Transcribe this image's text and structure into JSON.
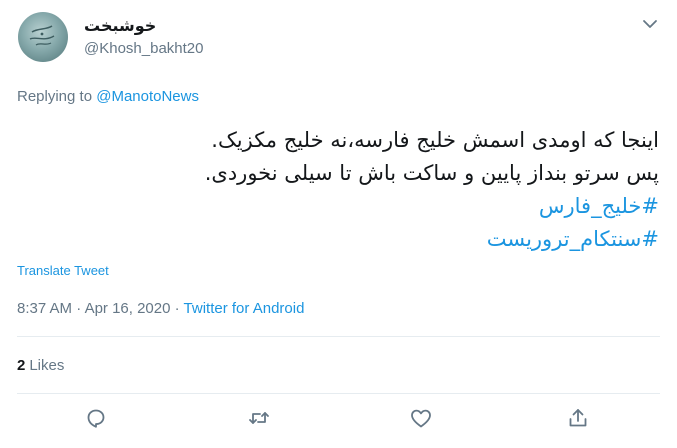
{
  "author": {
    "display_name": "خوشبخت",
    "handle": "@Khosh_bakht20"
  },
  "reply": {
    "prefix": "Replying to",
    "mention": "@ManotoNews"
  },
  "tweet": {
    "line1": "اینجا که اومدی اسمش خلیج فارسه،نه خلیج مکزیک.",
    "line2": "پس سرتو بنداز پایین و ساکت باش تا سیلی نخوردی.",
    "hashtag1": "#خلیج_فارس",
    "hashtag2": "#سنتکام_تروریست"
  },
  "translate_label": "Translate Tweet",
  "meta": {
    "time": "8:37 AM",
    "separator": "·",
    "date": "Apr 16, 2020",
    "source": "Twitter for Android"
  },
  "stats": {
    "likes_count": "2",
    "likes_label": "Likes"
  },
  "icons": {
    "reply": "reply-icon",
    "retweet": "retweet-icon",
    "like": "heart-icon",
    "share": "share-icon",
    "caret": "chevron-down-icon"
  },
  "colors": {
    "accent": "#1b95e0",
    "muted": "#657786",
    "text": "#14171a",
    "divider": "#e6ecf0"
  }
}
